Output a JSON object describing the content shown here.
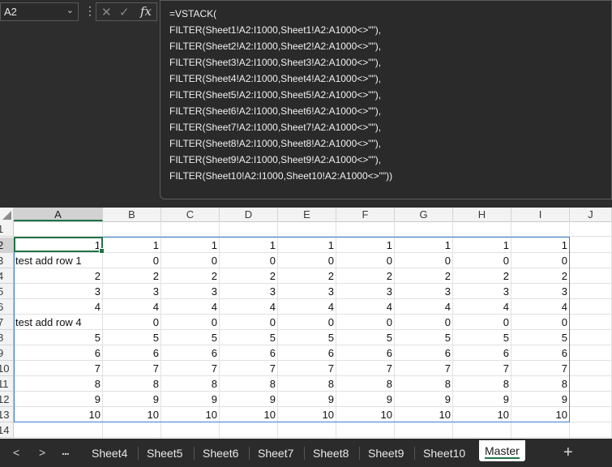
{
  "namebox": {
    "value": "A2"
  },
  "formula_lines": [
    "=VSTACK(",
    "FILTER(Sheet1!A2:I1000,Sheet1!A2:A1000<>\"\"),",
    "FILTER(Sheet2!A2:I1000,Sheet2!A2:A1000<>\"\"),",
    "FILTER(Sheet3!A2:I1000,Sheet3!A2:A1000<>\"\"),",
    "FILTER(Sheet4!A2:I1000,Sheet4!A2:A1000<>\"\"),",
    "FILTER(Sheet5!A2:I1000,Sheet5!A2:A1000<>\"\"),",
    "FILTER(Sheet6!A2:I1000,Sheet6!A2:A1000<>\"\"),",
    "FILTER(Sheet7!A2:I1000,Sheet7!A2:A1000<>\"\"),",
    "FILTER(Sheet8!A2:I1000,Sheet8!A2:A1000<>\"\"),",
    "FILTER(Sheet9!A2:I1000,Sheet9!A2:A1000<>\"\"),",
    "FILTER(Sheet10!A2:I1000,Sheet10!A2:A1000<>\"\"))"
  ],
  "columns": [
    "A",
    "B",
    "C",
    "D",
    "E",
    "F",
    "G",
    "H",
    "I",
    "J"
  ],
  "row_numbers": [
    "1",
    "2",
    "3",
    "4",
    "5",
    "6",
    "7",
    "8",
    "9",
    "10",
    "11",
    "12",
    "13",
    "14"
  ],
  "rows": [
    [
      "1",
      "1",
      "1",
      "1",
      "1",
      "1",
      "1",
      "1",
      "1"
    ],
    [
      "test add row 1",
      "0",
      "0",
      "0",
      "0",
      "0",
      "0",
      "0",
      "0"
    ],
    [
      "2",
      "2",
      "2",
      "2",
      "2",
      "2",
      "2",
      "2",
      "2"
    ],
    [
      "3",
      "3",
      "3",
      "3",
      "3",
      "3",
      "3",
      "3",
      "3"
    ],
    [
      "4",
      "4",
      "4",
      "4",
      "4",
      "4",
      "4",
      "4",
      "4"
    ],
    [
      "test add row 4",
      "0",
      "0",
      "0",
      "0",
      "0",
      "0",
      "0",
      "0"
    ],
    [
      "5",
      "5",
      "5",
      "5",
      "5",
      "5",
      "5",
      "5",
      "5"
    ],
    [
      "6",
      "6",
      "6",
      "6",
      "6",
      "6",
      "6",
      "6",
      "6"
    ],
    [
      "7",
      "7",
      "7",
      "7",
      "7",
      "7",
      "7",
      "7",
      "7"
    ],
    [
      "8",
      "8",
      "8",
      "8",
      "8",
      "8",
      "8",
      "8",
      "8"
    ],
    [
      "9",
      "9",
      "9",
      "9",
      "9",
      "9",
      "9",
      "9",
      "9"
    ],
    [
      "10",
      "10",
      "10",
      "10",
      "10",
      "10",
      "10",
      "10",
      "10"
    ]
  ],
  "sheet_tabs": [
    "Sheet4",
    "Sheet5",
    "Sheet6",
    "Sheet7",
    "Sheet8",
    "Sheet9",
    "Sheet10",
    "Master"
  ],
  "active_tab": "Master",
  "nav": {
    "prev": "<",
    "next": ">",
    "more": "...",
    "add": "+"
  },
  "fx_label": "fx",
  "colors": {
    "accent": "#217346",
    "spill_border": "#3c7fd1"
  }
}
